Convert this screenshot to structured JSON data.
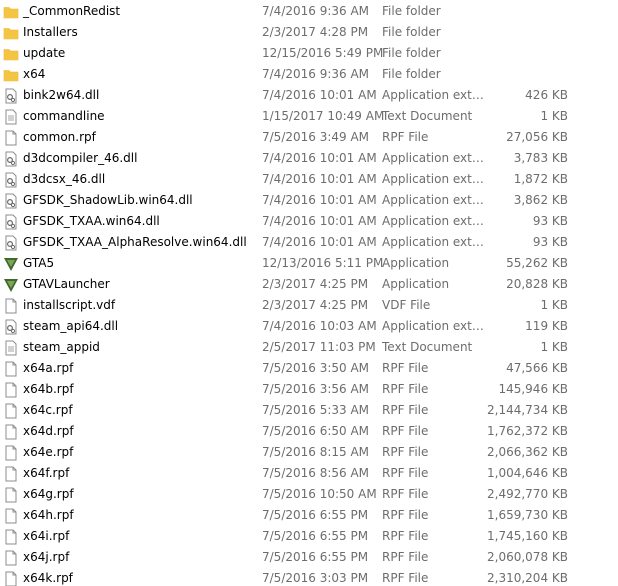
{
  "colors": {
    "folder": "#f4c542",
    "folder_tab": "#e8b32e",
    "gta_green": "#3e6b2a",
    "meta_text": "#6d6d6d"
  },
  "files": [
    {
      "name": "_CommonRedist",
      "date": "7/4/2016 9:36 AM",
      "type": "File folder",
      "size": "",
      "icon": "folder-icon"
    },
    {
      "name": "Installers",
      "date": "2/3/2017 4:28 PM",
      "type": "File folder",
      "size": "",
      "icon": "folder-icon"
    },
    {
      "name": "update",
      "date": "12/15/2016 5:49 PM",
      "type": "File folder",
      "size": "",
      "icon": "folder-icon"
    },
    {
      "name": "x64",
      "date": "7/4/2016 9:36 AM",
      "type": "File folder",
      "size": "",
      "icon": "folder-icon"
    },
    {
      "name": "bink2w64.dll",
      "date": "7/4/2016 10:01 AM",
      "type": "Application extens...",
      "size": "426 KB",
      "icon": "dll-icon"
    },
    {
      "name": "commandline",
      "date": "1/15/2017 10:49 AM",
      "type": "Text Document",
      "size": "1 KB",
      "icon": "document-icon"
    },
    {
      "name": "common.rpf",
      "date": "7/5/2016 3:49 AM",
      "type": "RPF File",
      "size": "27,056 KB",
      "icon": "file-icon"
    },
    {
      "name": "d3dcompiler_46.dll",
      "date": "7/4/2016 10:01 AM",
      "type": "Application extens...",
      "size": "3,783 KB",
      "icon": "dll-icon"
    },
    {
      "name": "d3dcsx_46.dll",
      "date": "7/4/2016 10:01 AM",
      "type": "Application extens...",
      "size": "1,872 KB",
      "icon": "dll-icon"
    },
    {
      "name": "GFSDK_ShadowLib.win64.dll",
      "date": "7/4/2016 10:01 AM",
      "type": "Application extens...",
      "size": "3,862 KB",
      "icon": "dll-icon"
    },
    {
      "name": "GFSDK_TXAA.win64.dll",
      "date": "7/4/2016 10:01 AM",
      "type": "Application extens...",
      "size": "93 KB",
      "icon": "dll-icon"
    },
    {
      "name": "GFSDK_TXAA_AlphaResolve.win64.dll",
      "date": "7/4/2016 10:01 AM",
      "type": "Application extens...",
      "size": "93 KB",
      "icon": "dll-icon"
    },
    {
      "name": "GTA5",
      "date": "12/13/2016 5:11 PM",
      "type": "Application",
      "size": "55,262 KB",
      "icon": "gta-app-icon"
    },
    {
      "name": "GTAVLauncher",
      "date": "2/3/2017 4:25 PM",
      "type": "Application",
      "size": "20,828 KB",
      "icon": "gta-app-icon"
    },
    {
      "name": "installscript.vdf",
      "date": "2/3/2017 4:25 PM",
      "type": "VDF File",
      "size": "1 KB",
      "icon": "file-icon"
    },
    {
      "name": "steam_api64.dll",
      "date": "7/4/2016 10:03 AM",
      "type": "Application extens...",
      "size": "119 KB",
      "icon": "dll-icon"
    },
    {
      "name": "steam_appid",
      "date": "2/5/2017 11:03 PM",
      "type": "Text Document",
      "size": "1 KB",
      "icon": "document-icon"
    },
    {
      "name": "x64a.rpf",
      "date": "7/5/2016 3:50 AM",
      "type": "RPF File",
      "size": "47,566 KB",
      "icon": "file-icon"
    },
    {
      "name": "x64b.rpf",
      "date": "7/5/2016 3:56 AM",
      "type": "RPF File",
      "size": "145,946 KB",
      "icon": "file-icon"
    },
    {
      "name": "x64c.rpf",
      "date": "7/5/2016 5:33 AM",
      "type": "RPF File",
      "size": "2,144,734 KB",
      "icon": "file-icon"
    },
    {
      "name": "x64d.rpf",
      "date": "7/5/2016 6:50 AM",
      "type": "RPF File",
      "size": "1,762,372 KB",
      "icon": "file-icon"
    },
    {
      "name": "x64e.rpf",
      "date": "7/5/2016 8:15 AM",
      "type": "RPF File",
      "size": "2,066,362 KB",
      "icon": "file-icon"
    },
    {
      "name": "x64f.rpf",
      "date": "7/5/2016 8:56 AM",
      "type": "RPF File",
      "size": "1,004,646 KB",
      "icon": "file-icon"
    },
    {
      "name": "x64g.rpf",
      "date": "7/5/2016 10:50 AM",
      "type": "RPF File",
      "size": "2,492,770 KB",
      "icon": "file-icon"
    },
    {
      "name": "x64h.rpf",
      "date": "7/5/2016 6:55 PM",
      "type": "RPF File",
      "size": "1,659,730 KB",
      "icon": "file-icon"
    },
    {
      "name": "x64i.rpf",
      "date": "7/5/2016 6:55 PM",
      "type": "RPF File",
      "size": "1,745,160 KB",
      "icon": "file-icon"
    },
    {
      "name": "x64j.rpf",
      "date": "7/5/2016 6:55 PM",
      "type": "RPF File",
      "size": "2,060,078 KB",
      "icon": "file-icon"
    },
    {
      "name": "x64k.rpf",
      "date": "7/5/2016 3:03 PM",
      "type": "RPF File",
      "size": "2,310,204 KB",
      "icon": "file-icon"
    }
  ]
}
